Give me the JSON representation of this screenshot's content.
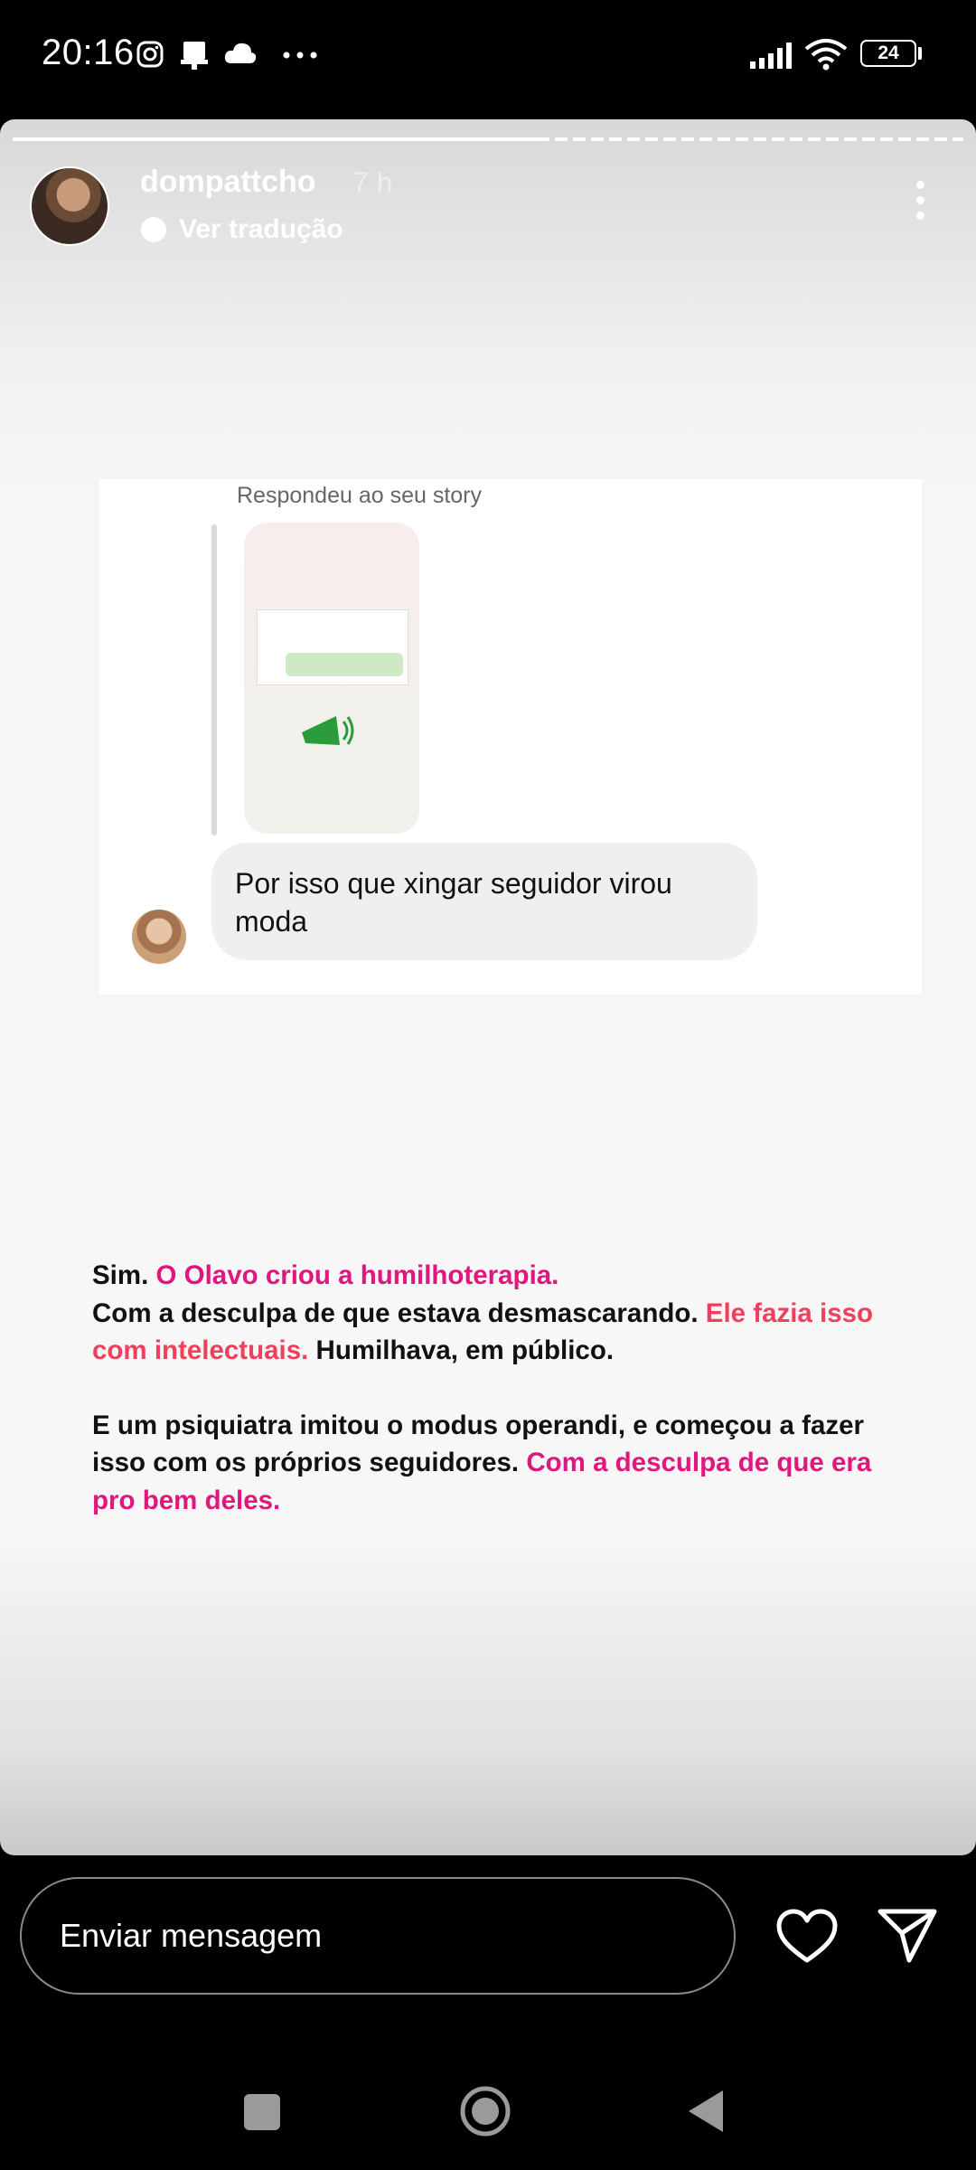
{
  "status_bar": {
    "time": "20:16",
    "icons": [
      "instagram-icon",
      "notification-icon",
      "cloud-icon",
      "more-dots-icon",
      "signal-icon",
      "wifi-icon"
    ],
    "battery": "24"
  },
  "story": {
    "username": "dompattcho",
    "time_ago": "7 h",
    "translate": "Ver tradução",
    "progress_fraction": 0.56
  },
  "reply_card": {
    "header": "Respondeu ao seu story",
    "message": "Por isso que xingar seguidor virou moda"
  },
  "caption": {
    "p1": [
      {
        "text": "Sim. ",
        "style": "plain"
      },
      {
        "text": "O Olavo criou a humilhoterapia.",
        "style": "highlight"
      }
    ],
    "p2": [
      {
        "text": "Com a desculpa de que estava desmascarando. ",
        "style": "plain"
      },
      {
        "text": "Ele fazia isso com intelectuais.",
        "style": "highlight-red"
      },
      {
        "text": " Humilhava, em público.",
        "style": "plain"
      }
    ],
    "p3": [
      {
        "text": "E um psiquiatra imitou o modus operandi, e começou a fazer isso com os próprios seguidores. ",
        "style": "plain"
      },
      {
        "text": "Com a desculpa de que era pro bem deles.",
        "style": "highlight"
      }
    ]
  },
  "bottom": {
    "message_placeholder": "Enviar mensagem"
  },
  "colors": {
    "highlight": "#e0177c",
    "highlight_red": "#f0405b"
  }
}
